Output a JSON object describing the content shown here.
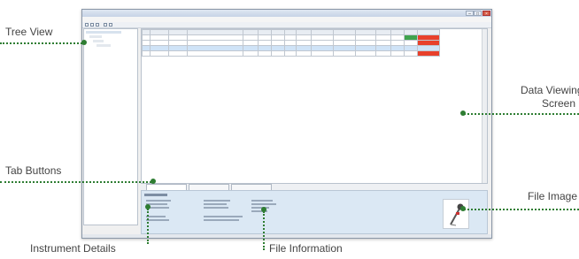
{
  "callouts": {
    "tree_view": "Tree View",
    "data_viewing_line1": "Data Viewing",
    "data_viewing_line2": "Screen",
    "tab_buttons": "Tab Buttons",
    "file_image": "File Image",
    "instrument_details": "Instrument Details",
    "file_information": "File Information"
  },
  "colors": {
    "callout_line": "#2e7d32",
    "alert_cell": "#e8402b",
    "ok_cell": "#3fa34d"
  },
  "icons": {
    "minimize": "minimize-icon",
    "maximize": "maximize-icon",
    "close": "close-icon",
    "file_image": "instrument-image-icon"
  }
}
